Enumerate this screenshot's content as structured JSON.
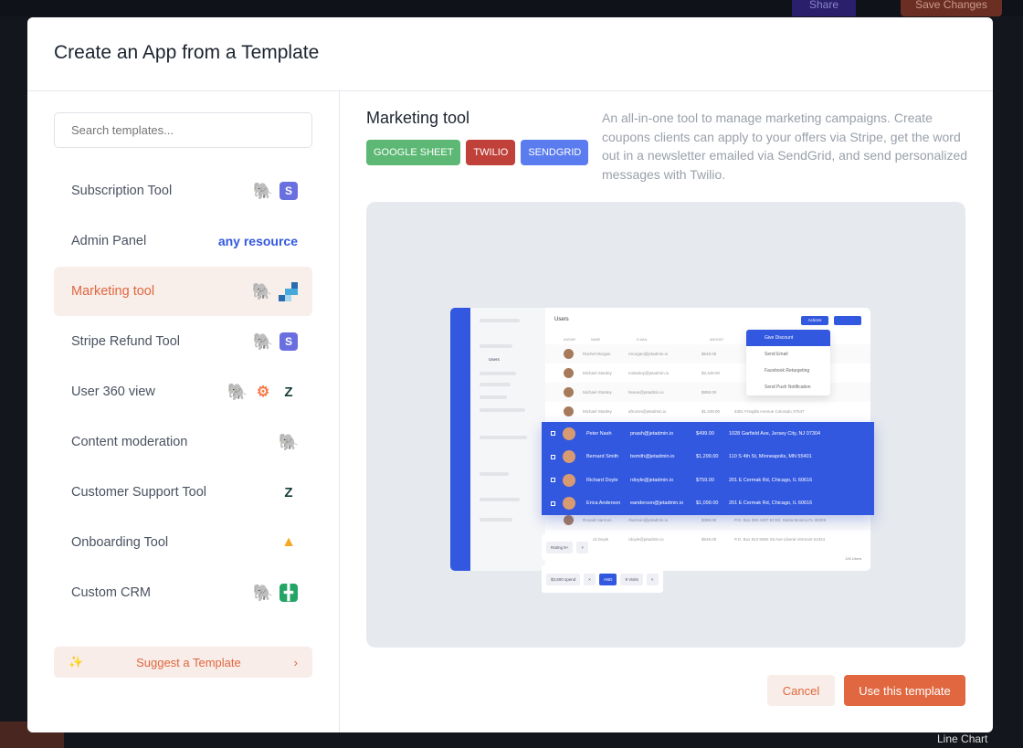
{
  "background": {
    "share_label": "Share",
    "save_label": "Save Changes",
    "line_chart_label": "Line Chart"
  },
  "modal": {
    "title": "Create an App from a Template",
    "search": {
      "placeholder": "Search templates...",
      "value": ""
    },
    "templates": [
      {
        "label": "Subscription Tool",
        "icons": [
          "postgresql-icon",
          "stripe-icon"
        ]
      },
      {
        "label": "Admin Panel",
        "resource_text": "any resource"
      },
      {
        "label": "Marketing tool",
        "icons": [
          "postgresql-icon",
          "segment-icon"
        ],
        "selected": true
      },
      {
        "label": "Stripe Refund Tool",
        "icons": [
          "postgresql-icon",
          "stripe-icon"
        ]
      },
      {
        "label": "User 360 view",
        "icons": [
          "postgresql-icon",
          "hubspot-icon",
          "zendesk-icon"
        ]
      },
      {
        "label": "Content moderation",
        "icons": [
          "postgresql-icon"
        ]
      },
      {
        "label": "Customer Support Tool",
        "icons": [
          "zendesk-icon"
        ]
      },
      {
        "label": "Onboarding Tool",
        "icons": [
          "firebase-icon"
        ]
      },
      {
        "label": "Custom CRM",
        "icons": [
          "postgresql-icon",
          "google-sheets-icon"
        ]
      }
    ],
    "suggest_label": "Suggest a Template",
    "detail": {
      "title": "Marketing tool",
      "tags": [
        {
          "label": "GOOGLE SHEET",
          "color": "#5cb874"
        },
        {
          "label": "TWILIO",
          "color": "#c0403a"
        },
        {
          "label": "SENDGRID",
          "color": "#5b7cef"
        }
      ],
      "description": "An all-in-one tool to manage marketing campaigns. Create coupons clients can apply to your offers via Stripe, get the word out in a newsletter emailed via SendGrid, and send personalized messages with Twilio.",
      "preview": {
        "page_title": "Users",
        "nav_item": "Users",
        "actions_label": "Actions",
        "columns": [
          "AVATAR",
          "NAME",
          "E-MAIL",
          "AMOUNT"
        ],
        "rows": [
          {
            "name": "Rachel Morgan",
            "email": "rmorgan@jetadmin.io",
            "amount": "$649.00",
            "address": ""
          },
          {
            "name": "Michael Stanley",
            "email": "mstanley@jetadmin.io",
            "amount": "$2,449.00",
            "address": ""
          },
          {
            "name": "Michael Stanley",
            "email": "bsean@jetadmin.io",
            "amount": "$859.00",
            "address": ""
          },
          {
            "name": "Michael Stanley",
            "email": "afrozen@jetadmin.io",
            "amount": "$1,349.00",
            "address": "6351 Fringilla Avenue Colorado 37547"
          }
        ],
        "selected_rows": [
          {
            "name": "Peter Nash",
            "email": "pnash@jetadmin.io",
            "amount": "$499.00",
            "address": "1028 Garfield Ave, Jersey City, NJ 07304"
          },
          {
            "name": "Bernard Smith",
            "email": "bsmith@jetadmin.io",
            "amount": "$1,299.00",
            "address": "110 S 4th St, Minneapolis, MN 55401"
          },
          {
            "name": "Richard Doyle",
            "email": "rdoyle@jetadmin.io",
            "amount": "$759.00",
            "address": "201 E Cermak Rd, Chicago, IL 60616"
          },
          {
            "name": "Erica Anderson",
            "email": "eanderson@jetadmin.io",
            "amount": "$1,099.00",
            "address": "201 E Cermak Rd, Chicago, IL 60616"
          }
        ],
        "after_rows": [
          {
            "name": "Ronald Harmon",
            "email": "rharmon@jetadmin.io",
            "amount": "$399.00",
            "address": "P.O. Box 360 4407 Et Rd. Santa Monica FL 30309"
          },
          {
            "name": "Richard Doyle",
            "email": "rdoyle@jetadmin.io",
            "amount": "$649.00",
            "address": "P.O. Box 813 5982 Sit Ave Liberal Vermont 51324"
          }
        ],
        "menu": [
          "Give Discount",
          "Send Email",
          "Facebook Retargeting",
          "Send Push Notification"
        ],
        "filters": {
          "rating": "Rating 8+",
          "spend": "$3,500 spend",
          "and": "AND",
          "visits": "9 Visits"
        },
        "count": "128 Users"
      }
    },
    "cancel_label": "Cancel",
    "use_label": "Use this template",
    "accent": "#e0673f"
  }
}
